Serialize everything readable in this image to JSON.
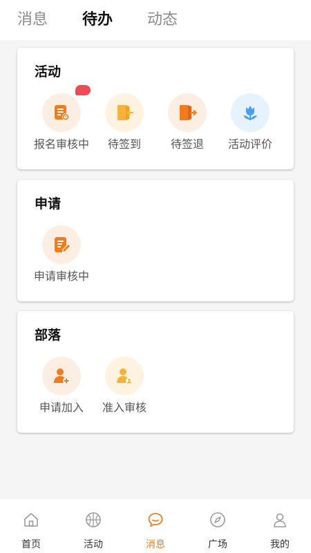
{
  "top_tabs": [
    {
      "label": "消息",
      "active": false
    },
    {
      "label": "待办",
      "active": true
    },
    {
      "label": "动态",
      "active": false
    }
  ],
  "sections": [
    {
      "title": "活动",
      "items": [
        {
          "label": "报名审核中",
          "icon": "document-review-icon",
          "color": "#f07c1e",
          "bg": "#fdeee3",
          "badge": true
        },
        {
          "label": "待签到",
          "icon": "door-enter-icon",
          "color": "#f6b23b",
          "bg": "#fef3e1",
          "badge": false
        },
        {
          "label": "待签退",
          "icon": "door-exit-icon",
          "color": "#f07c1e",
          "bg": "#fdeee3",
          "badge": false
        },
        {
          "label": "活动评价",
          "icon": "tulip-icon",
          "color": "#4b9ef5",
          "bg": "#e6f2fd",
          "badge": false
        }
      ]
    },
    {
      "title": "申请",
      "items": [
        {
          "label": "申请审核中",
          "icon": "edit-document-icon",
          "color": "#f07c1e",
          "bg": "#fdeee3",
          "badge": false
        }
      ]
    },
    {
      "title": "部落",
      "items": [
        {
          "label": "申请加入",
          "icon": "user-add-icon",
          "color": "#f07c1e",
          "bg": "#fdeee3",
          "badge": false
        },
        {
          "label": "准入审核",
          "icon": "user-check-icon",
          "color": "#f6b23b",
          "bg": "#fef3e1",
          "badge": false
        }
      ]
    }
  ],
  "bottom_nav": [
    {
      "label": "首页",
      "icon": "home-icon",
      "active": false
    },
    {
      "label": "活动",
      "icon": "basketball-icon",
      "active": false
    },
    {
      "label": "消息",
      "icon": "chat-bubble-icon",
      "active": true
    },
    {
      "label": "广场",
      "icon": "compass-icon",
      "active": false
    },
    {
      "label": "我的",
      "icon": "profile-icon",
      "active": false
    }
  ],
  "colors": {
    "accent": "#f07c1e",
    "badge": "#ee4b55",
    "inactive_nav": "#9a9a9a"
  }
}
